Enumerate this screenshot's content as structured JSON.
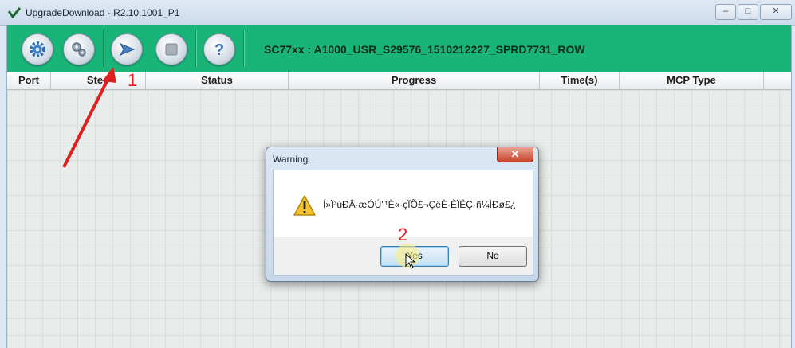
{
  "window": {
    "title": "UpgradeDownload  -  R2.10.1001_P1",
    "minimize_glyph": "–",
    "maximize_glyph": "□",
    "close_glyph": "✕"
  },
  "toolbar": {
    "firmware_label": "SC77xx : A1000_USR_S29576_1510212227_SPRD7731_ROW",
    "buttons": [
      {
        "name": "settings",
        "icon": "gear-icon"
      },
      {
        "name": "packet-settings",
        "icon": "gears-icon"
      },
      {
        "name": "start-download",
        "icon": "play-arrow-icon"
      },
      {
        "name": "stop",
        "icon": "stop-icon"
      },
      {
        "name": "help",
        "icon": "help-icon"
      }
    ],
    "accent_color": "#19b578"
  },
  "table": {
    "columns": [
      "Port",
      "Step",
      "Status",
      "Progress",
      "Time(s)",
      "MCP Type"
    ],
    "rows": []
  },
  "dialog": {
    "title": "Warning",
    "message": "Í»Ï³ùÐÂ·æÓÚ\"¹È«·çÏÕ£¬ÇëÈ·ÈÏÊÇ·ñ¼ÌÐø£¿",
    "yes_label": "Yes",
    "no_label": "No",
    "close_glyph": "✕"
  },
  "annotations": {
    "step1": "1",
    "step2": "2",
    "color": "#e02020"
  }
}
